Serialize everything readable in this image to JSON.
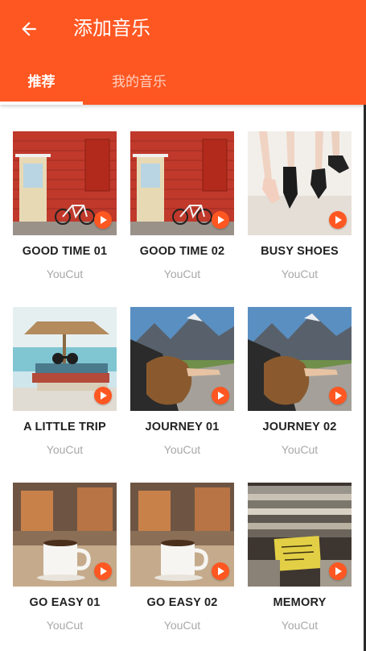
{
  "header": {
    "title": "添加音乐",
    "back_icon": "arrow-left-icon",
    "background_color": "#ff5722"
  },
  "tabs": [
    {
      "label": "推荐",
      "active": true
    },
    {
      "label": "我的音乐",
      "active": false
    }
  ],
  "tracks": [
    {
      "name": "GOOD TIME 01",
      "author": "YouCut",
      "thumbnail": "red-wall-bicycle"
    },
    {
      "name": "GOOD TIME 02",
      "author": "YouCut",
      "thumbnail": "red-wall-bicycle"
    },
    {
      "name": "BUSY SHOES",
      "author": "YouCut",
      "thumbnail": "dancer-shoes"
    },
    {
      "name": "A LITTLE TRIP",
      "author": "YouCut",
      "thumbnail": "beach-books-sunglasses"
    },
    {
      "name": "JOURNEY 01",
      "author": "YouCut",
      "thumbnail": "car-window-mountains"
    },
    {
      "name": "JOURNEY 02",
      "author": "YouCut",
      "thumbnail": "car-window-mountains"
    },
    {
      "name": "GO EASY 01",
      "author": "YouCut",
      "thumbnail": "coffee-mug"
    },
    {
      "name": "GO EASY 02",
      "author": "YouCut",
      "thumbnail": "coffee-mug"
    },
    {
      "name": "MEMORY",
      "author": "YouCut",
      "thumbnail": "stacked-books"
    }
  ],
  "play_icon": "play-icon",
  "accent_color": "#ff5722"
}
